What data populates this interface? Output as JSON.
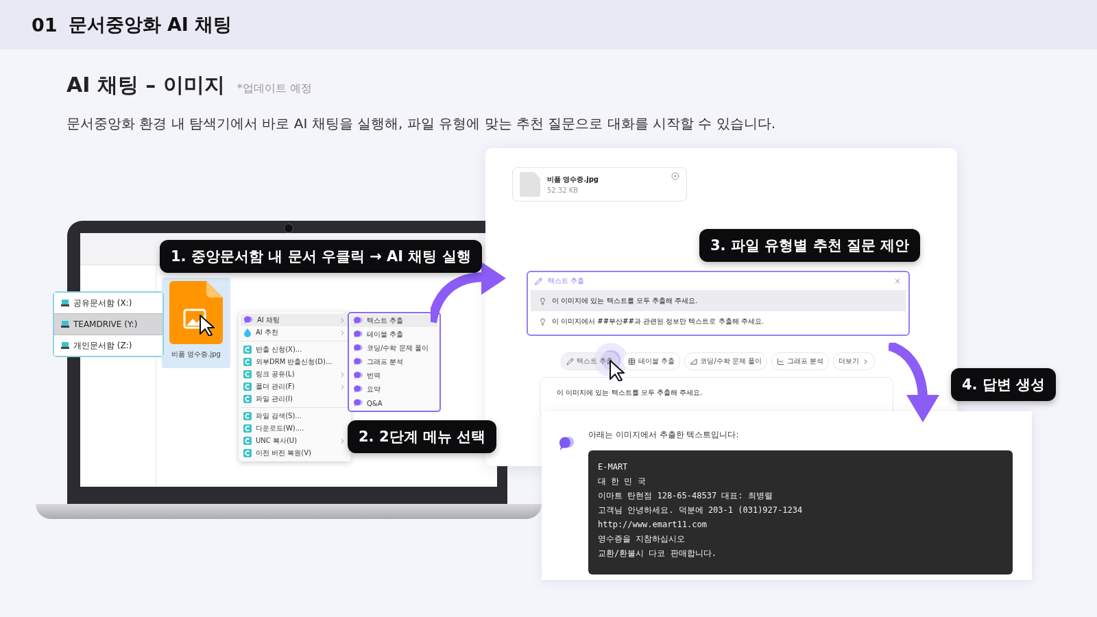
{
  "header": {
    "number": "01",
    "title": "문서중앙화 AI 채팅"
  },
  "section": {
    "title": "AI 채팅 – 이미지",
    "note": "*업데이트 예정",
    "description": "문서중앙화 환경 내 탐색기에서 바로 AI 채팅을 실행해, 파일 유형에 맞는 추천 질문으로 대화를 시작할 수 있습니다."
  },
  "steps": [
    {
      "label": "1. 중앙문서함 내 문서 우클릭 → AI 채팅 실행"
    },
    {
      "label": "2. 2단계 메뉴 선택"
    },
    {
      "label": "3. 파일 유형별 추천 질문 제안"
    },
    {
      "label": "4. 답변 생성"
    }
  ],
  "explorer": {
    "drives": [
      {
        "label": "공유문서함 (X:)",
        "selected": false
      },
      {
        "label": "TEAMDRIVE (Y:)",
        "selected": true
      },
      {
        "label": "개인문서함 (Z:)",
        "selected": false
      }
    ],
    "file": {
      "name": "비품 영수증.jpg"
    },
    "context_menu": [
      [
        {
          "label": "AI 채팅",
          "kind": "ai-chat",
          "submenu": true,
          "selected": true
        },
        {
          "label": "AI 추천",
          "kind": "ai-recommend",
          "submenu": true,
          "selected": false
        }
      ],
      [
        {
          "label": "반출 신청(X)...",
          "kind": "app",
          "submenu": false,
          "selected": false
        },
        {
          "label": "외부DRM 반출신청(D)...",
          "kind": "app",
          "submenu": false,
          "selected": false
        },
        {
          "label": "링크 공유(L)",
          "kind": "app",
          "submenu": true,
          "selected": false
        },
        {
          "label": "폴더 관리(F)",
          "kind": "app",
          "submenu": true,
          "selected": false
        },
        {
          "label": "파일 관리(I)",
          "kind": "app",
          "submenu": false,
          "selected": false
        }
      ],
      [
        {
          "label": "파일 검색(S)...",
          "kind": "app",
          "submenu": false,
          "selected": false
        },
        {
          "label": "다운로드(W)....",
          "kind": "app",
          "submenu": false,
          "selected": false
        },
        {
          "label": "UNC 복사(U)",
          "kind": "app",
          "submenu": true,
          "selected": false
        },
        {
          "label": "이전 버전 복원(V)",
          "kind": "app",
          "submenu": false,
          "selected": false
        }
      ]
    ],
    "submenu": [
      {
        "label": "텍스트 추출",
        "selected": true
      },
      {
        "label": "테이블 추출",
        "selected": false
      },
      {
        "label": "코딩/수학 문제 풀이",
        "selected": false
      },
      {
        "label": "그래프 분석",
        "selected": false
      },
      {
        "label": "번역",
        "selected": false
      },
      {
        "label": "요약",
        "selected": false
      },
      {
        "label": "Q&A",
        "selected": false
      }
    ]
  },
  "chat": {
    "attachment": {
      "name": "비품 영수증.jpg",
      "size": "52.32 KB"
    },
    "suggestions": {
      "title": "텍스트 추출",
      "items": [
        {
          "text": "이 이미지에 있는 텍스트를 모두 추출해 주세요.",
          "selected": true
        },
        {
          "text": "이 이미지에서 ##부산##과 관련된 정보만 텍스트로 추출해 주세요.",
          "selected": false
        }
      ]
    },
    "chips": [
      {
        "label": "텍스트 추출",
        "kind": "pencil",
        "selected": true
      },
      {
        "label": "테이블 추출",
        "kind": "table",
        "selected": false
      },
      {
        "label": "코딩/수학 문제 풀이",
        "kind": "ruler",
        "selected": false
      },
      {
        "label": "그래프 분석",
        "kind": "chart",
        "selected": false
      },
      {
        "label": "더보기",
        "kind": "more",
        "selected": false
      }
    ],
    "input": {
      "value": "이 이미지에 있는 텍스트를 모두 추출해 주세요."
    },
    "answer": {
      "intro": "아래는 이미지에서 추출한 텍스트입니다:",
      "code_lines": [
        "E-MART",
        "대 한 민 국",
        "이마트 탄현점 128-65-48537 대표: 최병렬",
        "고객님 안녕하세요. 덕분에 203-1 (031)927-1234",
        "http://www.emart11.com",
        "영수증을 지참하십시오",
        "교환/환불시 다코 판매합니다."
      ]
    }
  }
}
